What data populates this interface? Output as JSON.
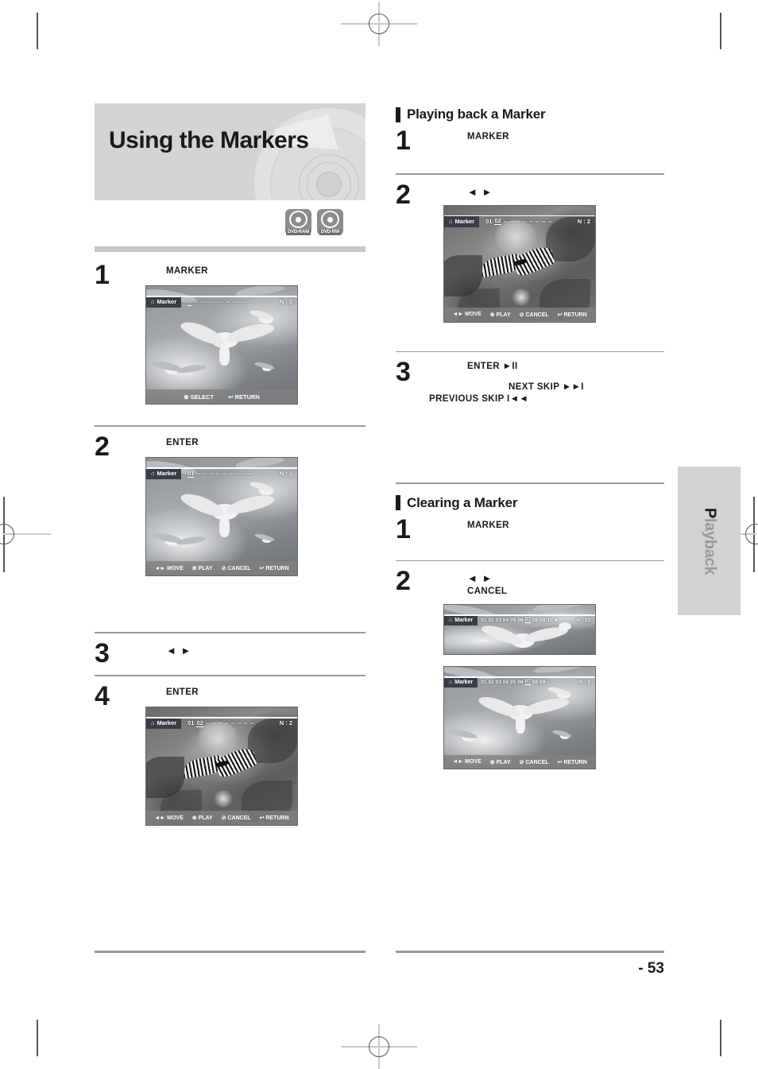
{
  "page": {
    "number": "- 53",
    "side_tab": {
      "first": "P",
      "rest": "layback"
    }
  },
  "banner": {
    "title": "Using the Markers",
    "badges": [
      {
        "label": "DVD-RAM",
        "name": "dvd-ram-badge"
      },
      {
        "label": "DVD·RW",
        "name": "dvd-rw-badge"
      }
    ]
  },
  "left_column": {
    "steps": [
      {
        "num": "1",
        "lines": [
          "MARKER"
        ]
      },
      {
        "num": "2",
        "lines": [
          "ENTER"
        ]
      },
      {
        "num": "3",
        "lines": [
          "◄ ►"
        ]
      },
      {
        "num": "4",
        "lines": [
          "ENTER"
        ]
      }
    ]
  },
  "right_column": {
    "section_playback": {
      "title": "Playing back a Marker",
      "steps": [
        {
          "num": "1",
          "lines": [
            "MARKER"
          ]
        },
        {
          "num": "2",
          "lines": [
            "◄ ►"
          ]
        },
        {
          "num": "3",
          "lines": [
            "ENTER    ►II",
            "NEXT SKIP  ►►I",
            "PREVIOUS SKIP I◄◄"
          ]
        }
      ]
    },
    "section_clearing": {
      "title": "Clearing a Marker",
      "steps": [
        {
          "num": "1",
          "lines": [
            "MARKER"
          ]
        },
        {
          "num": "2",
          "lines": [
            "◄ ►",
            "CANCEL"
          ]
        }
      ]
    }
  },
  "osd": {
    "marker_label": "Marker",
    "footer_select": [
      {
        "icon": "⊕",
        "label": "SELECT"
      },
      {
        "icon": "↩",
        "label": "RETURN"
      }
    ],
    "footer_full": [
      {
        "icon": "◄►",
        "label": "MOVE"
      },
      {
        "icon": "⊕",
        "label": "PLAY"
      },
      {
        "icon": "⊘",
        "label": "CANCEL"
      },
      {
        "icon": "↩",
        "label": "RETURN"
      }
    ]
  },
  "screens": {
    "l1": {
      "scene": "seagulls",
      "numbers": [
        "--",
        "--",
        "--",
        "--",
        "--",
        "--",
        "--",
        "--",
        "--",
        "--"
      ],
      "selected_index": 0,
      "count_label": "N : 0",
      "footer": "select"
    },
    "l2": {
      "scene": "seagulls",
      "numbers": [
        "01",
        "--",
        "--",
        "--",
        "--",
        "--",
        "--",
        "--",
        "--",
        "--"
      ],
      "selected_index": 0,
      "count_label": "N : 1",
      "footer": "full"
    },
    "l4": {
      "scene": "butterfly",
      "numbers": [
        "01",
        "02",
        "--",
        "--",
        "--",
        "--",
        "--",
        "--",
        "--",
        "--"
      ],
      "selected_index": 1,
      "count_label": "N : 2",
      "footer": "full"
    },
    "r2": {
      "scene": "butterfly",
      "numbers": [
        "01",
        "02",
        "--",
        "--",
        "--",
        "--",
        "--",
        "--",
        "--",
        "--"
      ],
      "selected_index": 1,
      "count_label": "N : 2",
      "footer": "full"
    },
    "r_clear_before": {
      "scene": "seagulls",
      "numbers": [
        "01",
        "02",
        "03",
        "04",
        "05",
        "06",
        "07",
        "08",
        "09",
        "10"
      ],
      "selected_index": 6,
      "count_label": "N : 10",
      "play_glyph": "►",
      "footer": "none"
    },
    "r_clear_after": {
      "scene": "seagulls",
      "numbers": [
        "01",
        "02",
        "03",
        "04",
        "05",
        "06",
        "07",
        "08",
        "09",
        "--"
      ],
      "selected_index": 6,
      "count_label": "N : 9",
      "footer": "full"
    }
  },
  "colors": {
    "banner_bg": "#d4d4d4",
    "rule_gray": "#9a9a9a",
    "rule_light": "#c6c6c6",
    "osd_tag": "#3a3d48",
    "tab_bg": "#d2d2d2"
  }
}
